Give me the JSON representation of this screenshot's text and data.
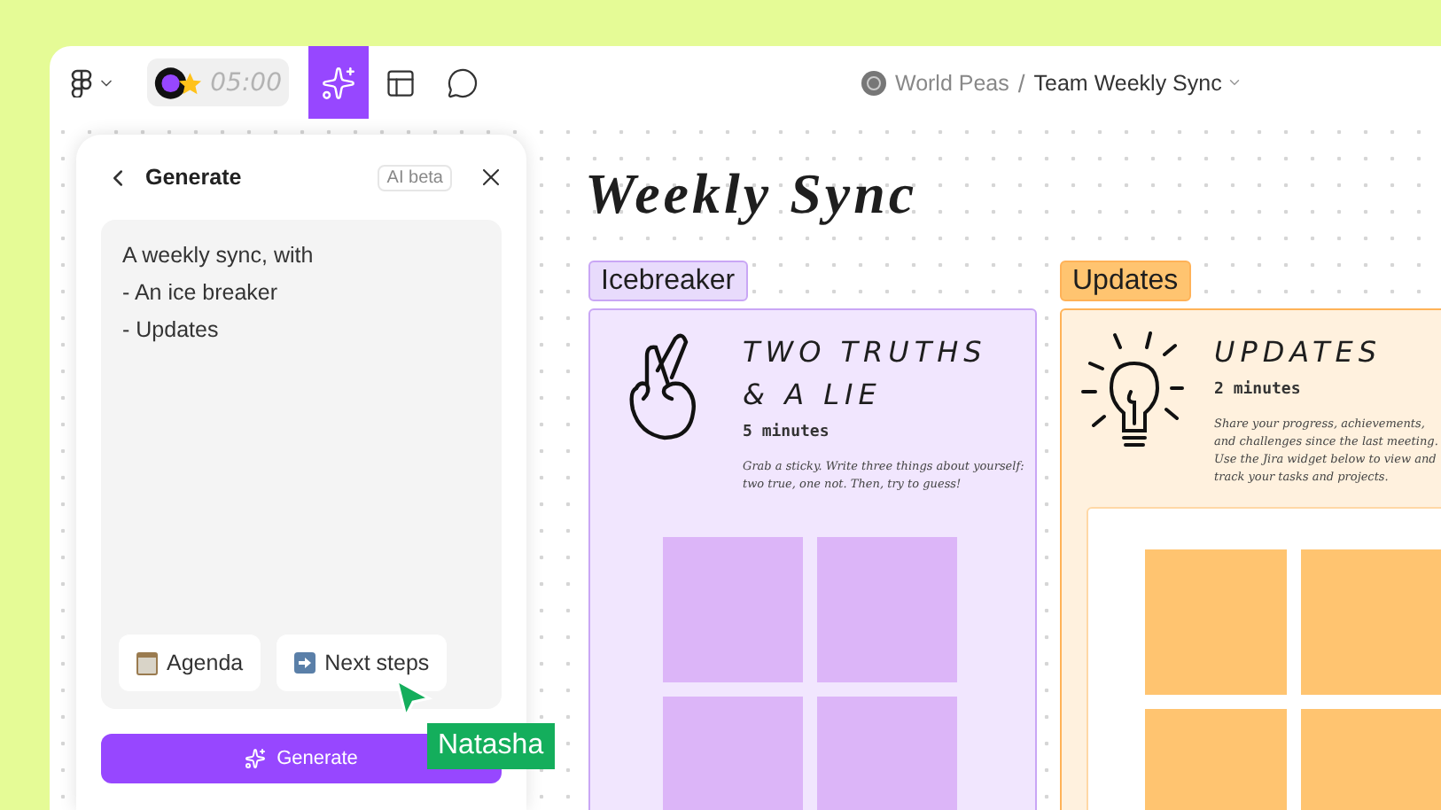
{
  "toolbar": {
    "timer": "05:00",
    "tools": [
      {
        "kind": "ai",
        "selected": true
      },
      {
        "kind": "layout",
        "selected": false
      },
      {
        "kind": "comment",
        "selected": false
      }
    ]
  },
  "breadcrumb": {
    "team": "World Peas",
    "separator": "/",
    "file": "Team Weekly Sync"
  },
  "generate_panel": {
    "title": "Generate",
    "badge": "AI beta",
    "prompt": "A weekly sync, with\n- An ice breaker\n- Updates",
    "chips": [
      {
        "kind": "notepad",
        "label": "Agenda"
      },
      {
        "kind": "arrow",
        "label": "Next steps"
      }
    ],
    "button": "Generate"
  },
  "board": {
    "title": "Weekly Sync",
    "sections": [
      {
        "kind": "icebreaker",
        "label": "Icebreaker",
        "title": "TWO TRUTHS & A LIE",
        "duration": "5 minutes",
        "description": "Grab a sticky. Write three things about yourself: two true, one not. Then, try to guess!"
      },
      {
        "kind": "updates",
        "label": "Updates",
        "title": "UPDATES",
        "duration": "2 minutes",
        "description": "Share your progress, achievements, and challenges since the last meeting. Use the Jira widget below to view and track your tasks and projects."
      }
    ]
  },
  "cursor": {
    "name": "Natasha",
    "color": "#14ae5c"
  }
}
